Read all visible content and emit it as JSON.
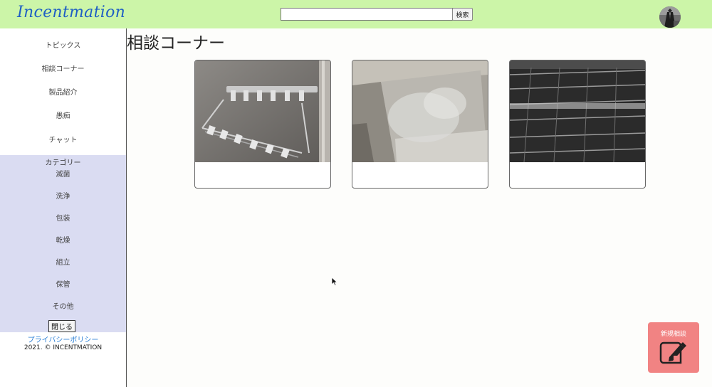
{
  "header": {
    "logo": "Incentmation",
    "search": {
      "placeholder": "",
      "value": "",
      "button_label": "検索"
    },
    "avatar_icon": "user-avatar-photo"
  },
  "sidebar": {
    "nav": [
      {
        "label": "トピックス"
      },
      {
        "label": "相談コーナー"
      },
      {
        "label": "製品紹介"
      },
      {
        "label": "愚痴"
      },
      {
        "label": "チャット"
      }
    ],
    "category_title": "カテゴリー",
    "categories": [
      {
        "label": "滅菌"
      },
      {
        "label": "洗浄"
      },
      {
        "label": "包装"
      },
      {
        "label": "乾燥"
      },
      {
        "label": "組立"
      },
      {
        "label": "保管"
      },
      {
        "label": "その他"
      }
    ],
    "close_label": "閉じる",
    "privacy_label": "プライバシーポリシー",
    "copyright": "2021. © INCENTMATION"
  },
  "main": {
    "title": "相談コーナー",
    "cards": [
      {
        "image": "metal-instrument-rack-photo"
      },
      {
        "image": "basin-sink-photo"
      },
      {
        "image": "wire-rack-shelves-photo"
      }
    ]
  },
  "fab": {
    "label": "新規相談",
    "icon": "edit-note-icon"
  },
  "colors": {
    "header_bg": "#ccf5a8",
    "logo": "#1f5fc4",
    "category_bg": "#dadcf2",
    "fab_bg": "#f18383",
    "link": "#2a7fd6"
  }
}
